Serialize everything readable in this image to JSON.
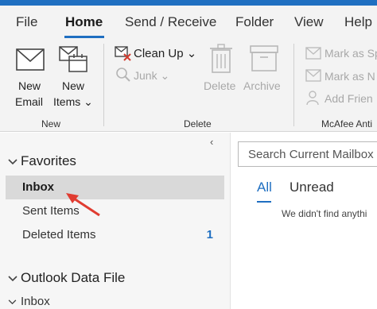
{
  "ribbon_tabs": [
    "File",
    "Home",
    "Send / Receive",
    "Folder",
    "View",
    "Help"
  ],
  "ribbon": {
    "new_email": {
      "line1": "New",
      "line2": "Email"
    },
    "new_items": {
      "line1": "New",
      "line2": "Items ⌄"
    },
    "group_new": "New",
    "clean_up": "Clean Up ⌄",
    "junk": "Junk ⌄",
    "delete": "Delete",
    "archive": "Archive",
    "group_delete": "Delete",
    "mark_as_spam": "Mark as Sp",
    "mark_as_not_spam": "Mark as N",
    "add_friend": "Add Frien",
    "group_mcafee": "McAfee Anti"
  },
  "nav": {
    "collapse_glyph": "‹",
    "favorites_label": "Favorites",
    "favorites": [
      {
        "label": "Inbox",
        "selected": true
      },
      {
        "label": "Sent Items"
      },
      {
        "label": "Deleted Items",
        "count": "1"
      }
    ],
    "data_file_label": "Outlook Data File",
    "data_file_inbox": "Inbox"
  },
  "mail": {
    "search_placeholder": "Search Current Mailbox",
    "filters": [
      "All",
      "Unread"
    ],
    "empty_message": "We didn't find anythi"
  },
  "colors": {
    "accent": "#1f6fc1",
    "arrow": "#e03c31",
    "selected_bg": "#d9d9d9"
  }
}
